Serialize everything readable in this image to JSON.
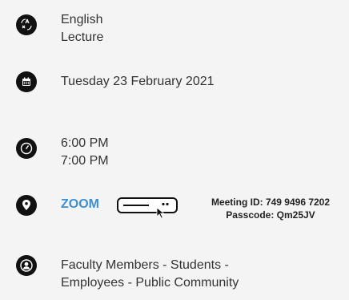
{
  "language": {
    "line1": "English",
    "line2": "Lecture",
    "icon": "translate-icon"
  },
  "date": {
    "text": "Tuesday 23 February 2021",
    "icon": "calendar-icon"
  },
  "time": {
    "start": "6:00 PM",
    "end": "7:00 PM",
    "icon": "clock-icon"
  },
  "location": {
    "link_label": "ZOOM",
    "meeting_id": "Meeting ID: 749 9496 7202",
    "passcode": "Passcode: Qm25JV",
    "icon": "map-pin-icon",
    "accent": "#3e8fd2"
  },
  "audience": {
    "line1": "Faculty Members - Students -",
    "line2": "Employees - Public Community",
    "icon": "user-circle-icon"
  }
}
